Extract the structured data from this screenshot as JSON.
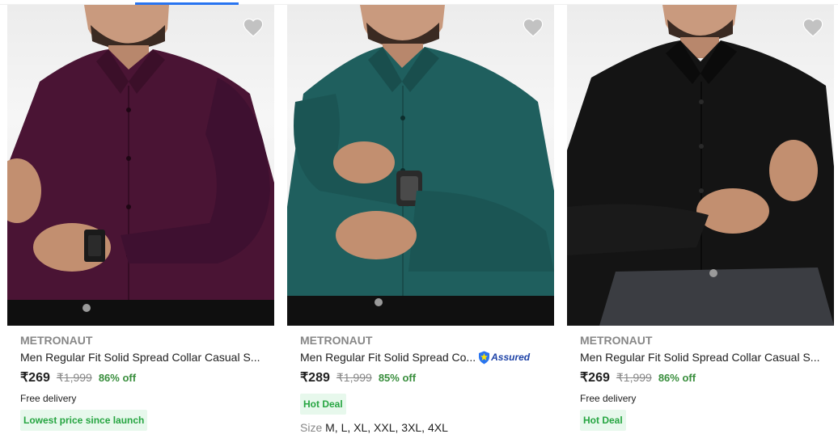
{
  "colors": {
    "price_green": "#388e3c",
    "tag_green": "#26a541",
    "tag_bg": "#e7f8ec",
    "grey": "#878787",
    "assured_blue": "#1c41a6",
    "accent": "#2874f0"
  },
  "products": [
    {
      "brand": "METRONAUT",
      "title": "Men Regular Fit Solid Spread Collar Casual S...",
      "price": "₹269",
      "mrp": "₹1,999",
      "discount": "86% off",
      "delivery": "Free delivery",
      "tag": "Lowest price since launch",
      "shirt_color": "#4a1434",
      "wishlist_icon": "heart-icon"
    },
    {
      "brand": "METRONAUT",
      "title": "Men Regular Fit Solid Spread Co...",
      "assured": "Assured",
      "price": "₹289",
      "mrp": "₹1,999",
      "discount": "85% off",
      "tag": "Hot Deal",
      "size_label": "Size",
      "sizes": "M, L, XL, XXL, 3XL, 4XL",
      "shirt_color": "#1f5f5e",
      "wishlist_icon": "heart-icon"
    },
    {
      "brand": "METRONAUT",
      "title": "Men Regular Fit Solid Spread Collar Casual S...",
      "price": "₹269",
      "mrp": "₹1,999",
      "discount": "86% off",
      "delivery": "Free delivery",
      "tag": "Hot Deal",
      "shirt_color": "#141414",
      "wishlist_icon": "heart-icon"
    }
  ]
}
